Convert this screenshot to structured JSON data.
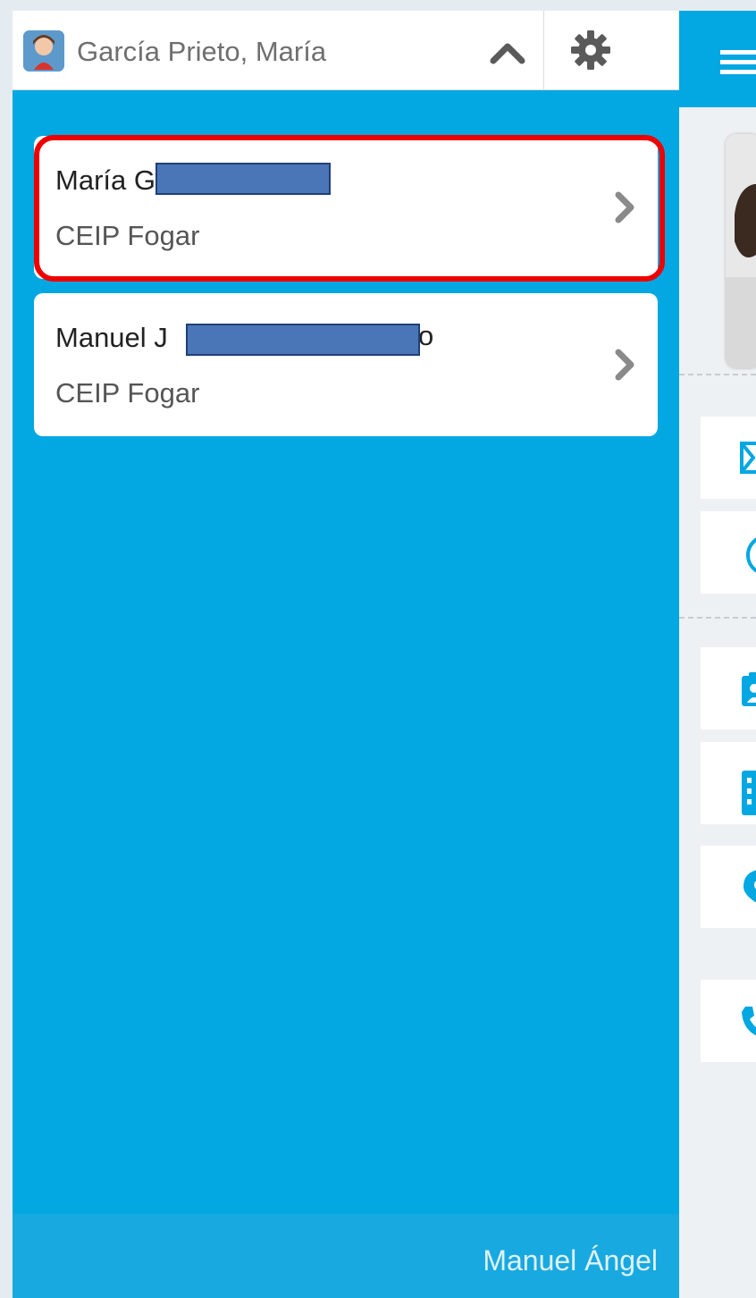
{
  "header": {
    "user_name": "García Prieto, María"
  },
  "students": [
    {
      "name_visible": "María G",
      "name_trail": "",
      "school": "CEIP Fogar"
    },
    {
      "name_visible": "Manuel J",
      "name_trail": "o",
      "school": "CEIP Fogar"
    }
  ],
  "footer": {
    "user_label": "Manuel Ángel"
  },
  "colors": {
    "accent": "#03a7e2",
    "highlight": "#ee0000",
    "redaction": "#4a76b8"
  },
  "icons": {
    "avatar": "avatar-icon",
    "collapse": "chevron-up-icon",
    "settings": "gear-icon",
    "card_arrow": "chevron-right-icon",
    "menu": "hamburger-icon",
    "tile_1": "mail-icon",
    "tile_2": "clock-icon",
    "tile_3": "clipboard-icon",
    "tile_4": "calendar-icon",
    "tile_5": "location-icon",
    "tile_6": "phone-icon"
  }
}
